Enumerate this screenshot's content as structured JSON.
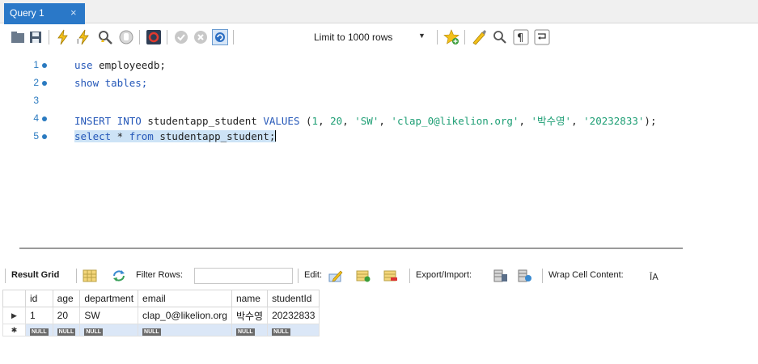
{
  "tab": {
    "title": "Query 1",
    "close_glyph": "×"
  },
  "toolbar": {
    "limit_label": "Limit to 1000 rows",
    "icons": [
      "folder-icon",
      "save-icon",
      "execute-icon",
      "execute-current-icon",
      "explain-icon",
      "stop-icon",
      "toggle-error-icon",
      "commit-icon",
      "rollback-icon",
      "autocommit-icon",
      "add-snippet-icon",
      "beautify-icon",
      "find-icon",
      "invisible-chars-icon",
      "wrap-icon"
    ]
  },
  "editor": {
    "lines": [
      {
        "num": "1",
        "has_dot": true,
        "tokens": [
          {
            "t": "use",
            "k": "kw"
          },
          {
            "t": " employeedb;",
            "k": ""
          }
        ]
      },
      {
        "num": "2",
        "has_dot": true,
        "tokens": [
          {
            "t": "show tables;",
            "k": "kw"
          }
        ]
      },
      {
        "num": "3",
        "has_dot": false,
        "tokens": []
      },
      {
        "num": "4",
        "has_dot": true,
        "tokens": [
          {
            "t": "INSERT INTO",
            "k": "kw"
          },
          {
            "t": " studentapp_student ",
            "k": ""
          },
          {
            "t": "VALUES",
            "k": "kw"
          },
          {
            "t": " (",
            "k": ""
          },
          {
            "t": "1",
            "k": "num"
          },
          {
            "t": ", ",
            "k": ""
          },
          {
            "t": "20",
            "k": "num"
          },
          {
            "t": ", ",
            "k": ""
          },
          {
            "t": "'SW'",
            "k": "str"
          },
          {
            "t": ", ",
            "k": ""
          },
          {
            "t": "'clap_0@likelion.org'",
            "k": "str"
          },
          {
            "t": ", ",
            "k": ""
          },
          {
            "t": "'박수영'",
            "k": "str"
          },
          {
            "t": ", ",
            "k": ""
          },
          {
            "t": "'20232833'",
            "k": "str"
          },
          {
            "t": ");",
            "k": ""
          }
        ]
      },
      {
        "num": "5",
        "has_dot": true,
        "selected": true,
        "tokens": [
          {
            "t": "select",
            "k": "kw"
          },
          {
            "t": " * ",
            "k": ""
          },
          {
            "t": "from",
            "k": "kw"
          },
          {
            "t": " studentapp_student;",
            "k": ""
          }
        ]
      }
    ]
  },
  "result_toolbar": {
    "result_grid_label": "Result Grid",
    "filter_label": "Filter Rows:",
    "filter_value": "",
    "edit_label": "Edit:",
    "export_label": "Export/Import:",
    "wrap_label": "Wrap Cell Content:"
  },
  "grid": {
    "columns": [
      "id",
      "age",
      "department",
      "email",
      "name",
      "studentId"
    ],
    "rows": [
      [
        "1",
        "20",
        "SW",
        "clap_0@likelion.org",
        "박수영",
        "20232833"
      ]
    ],
    "null_label": "NULL",
    "current_row_marker": "▶",
    "new_row_marker": "✱"
  }
}
